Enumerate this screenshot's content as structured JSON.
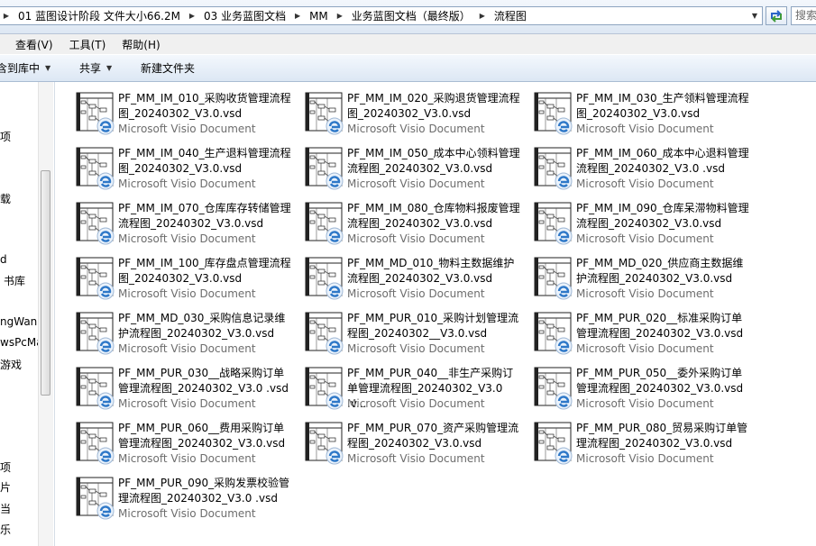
{
  "window": {
    "breadcrumbs": [
      "01 蓝图设计阶段 文件大小66.2M",
      "03 业务蓝图文档",
      "MM",
      "业务蓝图文档（最终版）",
      "流程图"
    ],
    "search_placeholder": "搜索 流程图"
  },
  "menu": [
    "查看(V)",
    "工具(T)",
    "帮助(H)"
  ],
  "toolbar": {
    "include_label": "含到库中",
    "share_label": "共享",
    "new_folder_label": "新建文件夹"
  },
  "nav": {
    "items": [
      "项",
      "载",
      "d",
      "书库",
      "ngWan",
      "wsPcMa",
      "游戏",
      "项",
      "片",
      "当",
      "乐"
    ]
  },
  "files": [
    {
      "name": "PF_MM_IM_010_采购收货管理流程图_20240302_V3.0.vsd",
      "type": "Microsoft Visio Document"
    },
    {
      "name": "PF_MM_IM_020_采购退货管理流程图_20240302_V3.0.vsd",
      "type": "Microsoft Visio Document"
    },
    {
      "name": "PF_MM_IM_030_生产领料管理流程图_20240302_V3.0.vsd",
      "type": "Microsoft Visio Document"
    },
    {
      "name": "PF_MM_IM_040_生产退料管理流程图_20240302_V3.0.vsd",
      "type": "Microsoft Visio Document"
    },
    {
      "name": "PF_MM_IM_050_成本中心领料管理流程图_20240302_V3.0.vsd",
      "type": "Microsoft Visio Document"
    },
    {
      "name": "PF_MM_IM_060_成本中心退料管理流程图_20240302_V3.0 .vsd",
      "type": "Microsoft Visio Document"
    },
    {
      "name": "PF_MM_IM_070_仓库库存转储管理流程图_20240302_V3.0.vsd",
      "type": "Microsoft Visio Document"
    },
    {
      "name": "PF_MM_IM_080_仓库物料报废管理流程图_20240302_V3.0.vsd",
      "type": "Microsoft Visio Document"
    },
    {
      "name": "PF_MM_IM_090_仓库呆滞物料管理流程图_20240302_V3.0.vsd",
      "type": "Microsoft Visio Document"
    },
    {
      "name": "PF_MM_IM_100_库存盘点管理流程图_20240302_V3.0.vsd",
      "type": "Microsoft Visio Document"
    },
    {
      "name": "PF_MM_MD_010_物料主数据维护流程图_20240302_V3.0.vsd",
      "type": "Microsoft Visio Document"
    },
    {
      "name": "PF_MM_MD_020_供应商主数据维护流程图_20240302_V3.0.vsd",
      "type": "Microsoft Visio Document"
    },
    {
      "name": "PF_MM_MD_030_采购信息记录维护流程图_20240302_V3.0.vsd",
      "type": "Microsoft Visio Document"
    },
    {
      "name": "PF_MM_PUR_010_采购计划管理流程图_20240302__V3.0.vsd",
      "type": "Microsoft Visio Document"
    },
    {
      "name": "PF_MM_PUR_020__标准采购订单管理流程图_20240302_V3.0.vsd",
      "type": "Microsoft Visio Document"
    },
    {
      "name": "PF_MM_PUR_030__战略采购订单管理流程图_20240302_V3.0 .vsd",
      "type": "Microsoft Visio Document"
    },
    {
      "name": "PF_MM_PUR_040__非生产采购订单管理流程图_20240302_V3.0 .v...",
      "type": "Microsoft Visio Document"
    },
    {
      "name": "PF_MM_PUR_050__委外采购订单管理流程图_20240302_V3.0.vsd",
      "type": "Microsoft Visio Document"
    },
    {
      "name": "PF_MM_PUR_060__费用采购订单管理流程图_20240302_V3.0.vsd",
      "type": "Microsoft Visio Document"
    },
    {
      "name": "PF_MM_PUR_070_资产采购管理流程图_20240302_V3.0.vsd",
      "type": "Microsoft Visio Document"
    },
    {
      "name": "PF_MM_PUR_080_贸易采购订单管理流程图_20240302_V3.0.vsd",
      "type": "Microsoft Visio Document"
    },
    {
      "name": "PF_MM_PUR_090_采购发票校验管理流程图_20240302_V3.0 .vsd",
      "type": "Microsoft Visio Document"
    }
  ]
}
